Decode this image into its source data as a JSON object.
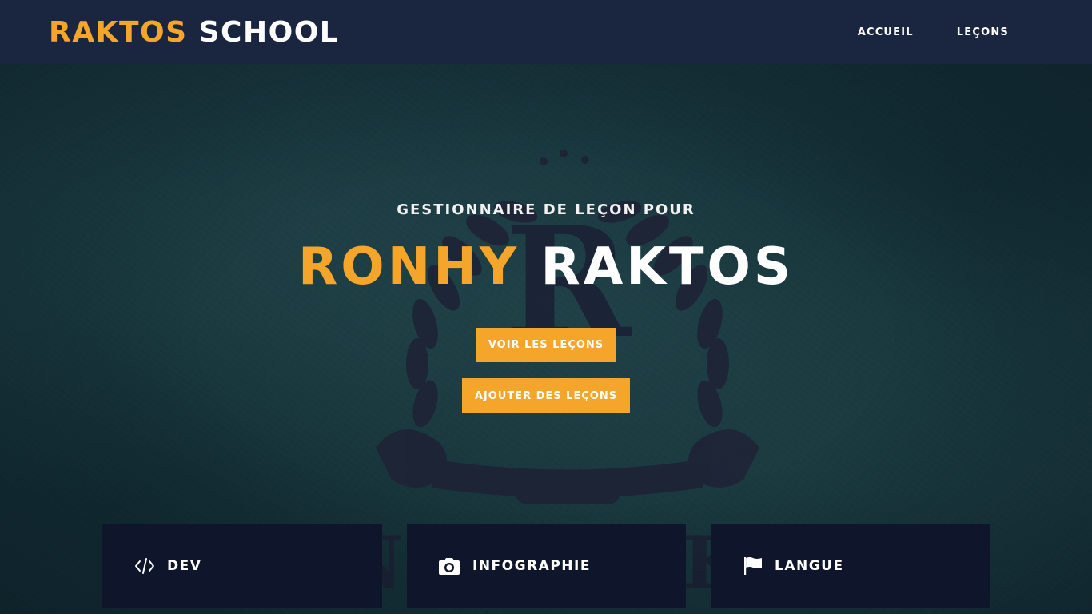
{
  "navbar": {
    "brand_accent": "RAKTOS",
    "brand_rest": "SCHOOL",
    "links": [
      {
        "label": "ACCUEIL"
      },
      {
        "label": "LEÇONS"
      }
    ]
  },
  "hero": {
    "subheading": "GESTIONNAIRE DE LEÇON POUR",
    "title_accent": "RONHY",
    "title_rest": "RAKTOS",
    "primary_button": "VOIR LES LEÇONS",
    "secondary_button": "AJOUTER DES LEÇONS",
    "background_emblem": {
      "letter": "R",
      "banner_text": "RONHY RAKTOS"
    }
  },
  "cards": [
    {
      "label": "DEV",
      "icon": "code-icon"
    },
    {
      "label": "INFOGRAPHIE",
      "icon": "camera-icon"
    },
    {
      "label": "LANGUE",
      "icon": "flag-icon"
    }
  ],
  "colors": {
    "accent": "#f4a52a",
    "navbar_bg": "#1a2540",
    "card_bg": "#0f152a",
    "hero_bg": "#1d4045"
  }
}
